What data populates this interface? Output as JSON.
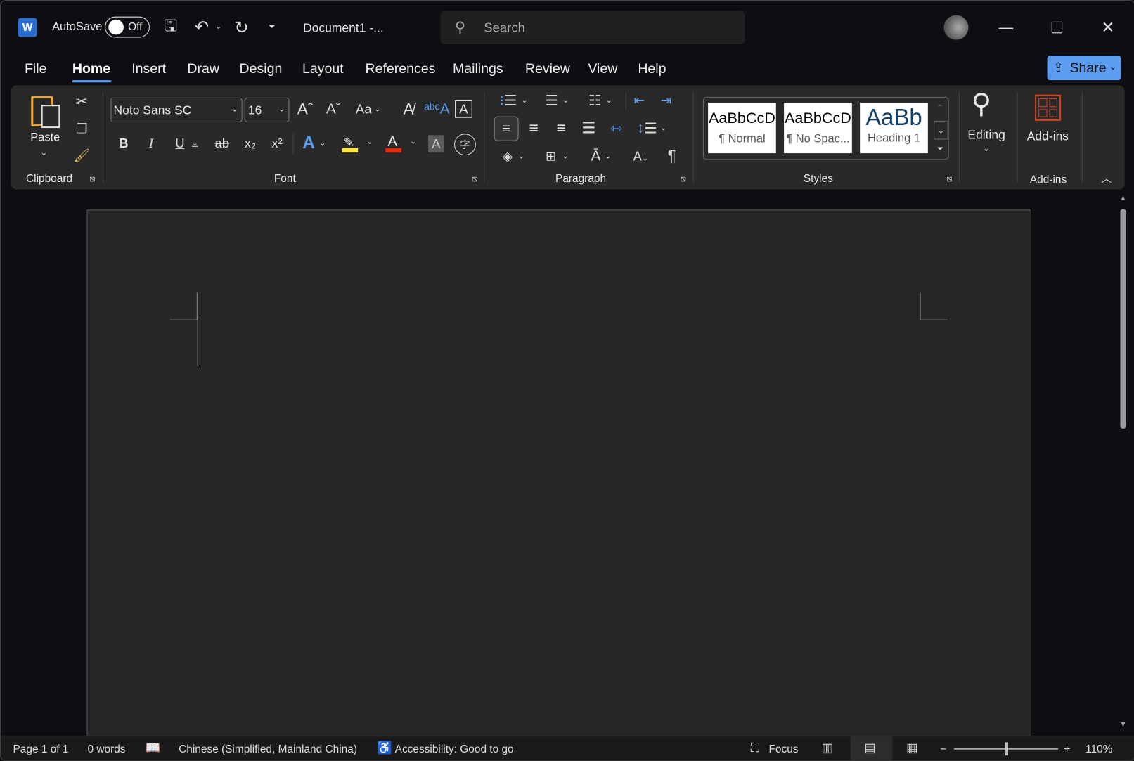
{
  "titlebar": {
    "autosave_label": "AutoSave",
    "autosave_state": "Off",
    "doc_title": "Document1  -...",
    "search_placeholder": "Search"
  },
  "tabs": [
    "File",
    "Home",
    "Insert",
    "Draw",
    "Design",
    "Layout",
    "References",
    "Mailings",
    "Review",
    "View",
    "Help"
  ],
  "active_tab": "Home",
  "share_label": "Share",
  "accent": "#5b9bf0",
  "ribbon": {
    "clipboard": {
      "label": "Clipboard",
      "paste": "Paste"
    },
    "font": {
      "label": "Font",
      "font_name": "Noto Sans SC",
      "font_size": "16",
      "bold": "B",
      "italic": "I",
      "underline": "U",
      "strike": "ab",
      "sub": "x₂",
      "sup": "x²",
      "case": "Aa"
    },
    "paragraph": {
      "label": "Paragraph"
    },
    "styles": {
      "label": "Styles",
      "items": [
        {
          "preview": "AaBbCcD",
          "name": "¶ Normal"
        },
        {
          "preview": "AaBbCcD",
          "name": "¶ No Spac..."
        },
        {
          "preview": "AaBb",
          "name": "Heading 1"
        }
      ]
    },
    "editing": {
      "label": "Editing"
    },
    "addins": {
      "label": "Add-ins",
      "group_label": "Add-ins"
    }
  },
  "status": {
    "page": "Page 1 of 1",
    "words": "0 words",
    "language": "Chinese (Simplified, Mainland China)",
    "accessibility": "Accessibility: Good to go",
    "focus": "Focus",
    "zoom": "110%"
  }
}
